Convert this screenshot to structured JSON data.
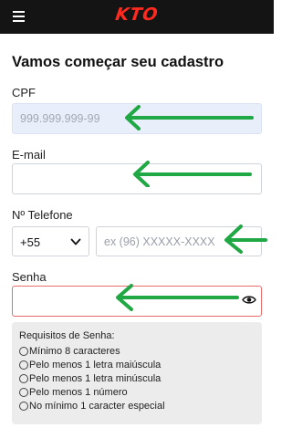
{
  "header": {
    "brand": "KTO"
  },
  "page": {
    "title": "Vamos começar seu cadastro"
  },
  "form": {
    "cpf": {
      "label": "CPF",
      "placeholder": "999.999.999-99",
      "value": ""
    },
    "email": {
      "label": "E-mail",
      "placeholder": "",
      "value": ""
    },
    "phone": {
      "label": "Nº Telefone",
      "country_code": "+55",
      "placeholder": "ex (96) XXXXX-XXXX",
      "value": ""
    },
    "password": {
      "label": "Senha",
      "placeholder": "",
      "value": ""
    }
  },
  "requirements": {
    "title": "Requisitos de Senha:",
    "items": [
      "Mínimo 8 caracteres",
      "Pelo menos 1 letra maiúscula",
      "Pelo menos 1 letra minúscula",
      "Pelo menos 1 número",
      "No mínimo 1 caracter especial"
    ]
  },
  "colors": {
    "topbar": "#141414",
    "brand": "#ff2a1f",
    "annotation_arrow": "#1fa843",
    "error_border": "#e86c6c",
    "cpf_field_bg": "#e8effb"
  },
  "icons": [
    "menu-icon",
    "chevron-down-icon",
    "eye-icon"
  ]
}
